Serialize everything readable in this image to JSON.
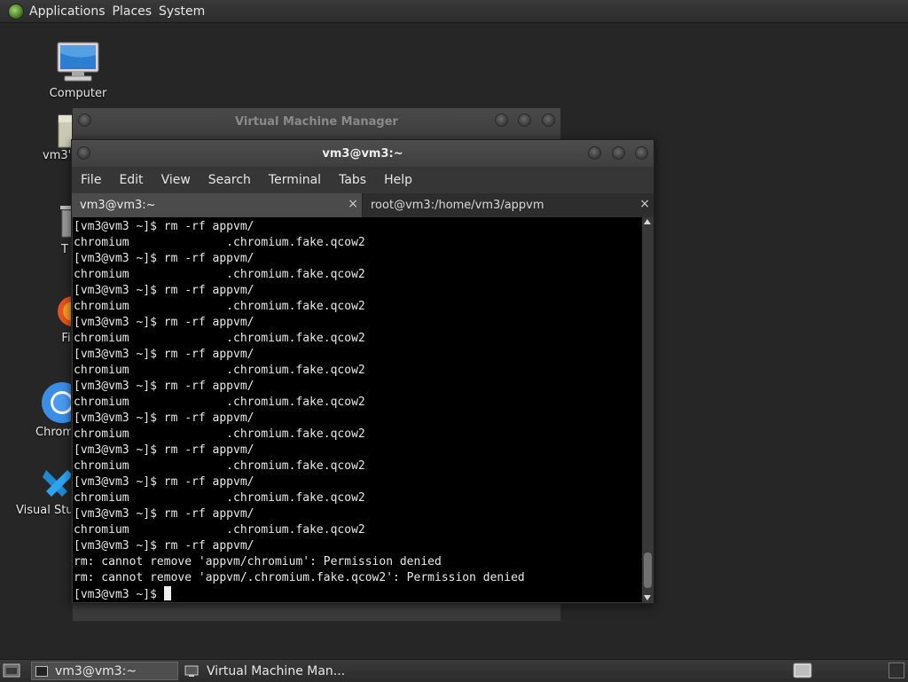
{
  "top_panel": {
    "menus": [
      "Applications",
      "Places",
      "System"
    ]
  },
  "desktop": {
    "icons": [
      {
        "label": "Computer"
      },
      {
        "label": "vm3'"
      },
      {
        "label": "T"
      },
      {
        "label": "Fi"
      },
      {
        "label": "Chrom"
      },
      {
        "label": "Visual Stuc"
      }
    ]
  },
  "vmm_window": {
    "title": "Virtual Machine Manager"
  },
  "terminal": {
    "title": "vm3@vm3:~",
    "menus": [
      "File",
      "Edit",
      "View",
      "Search",
      "Terminal",
      "Tabs",
      "Help"
    ],
    "tabs": [
      {
        "label": "vm3@vm3:~",
        "close": "×"
      },
      {
        "label": "root@vm3:/home/vm3/appvm",
        "close": "×"
      }
    ],
    "lines": [
      "[vm3@vm3 ~]$ rm -rf appvm/",
      "chromium              .chromium.fake.qcow2",
      "[vm3@vm3 ~]$ rm -rf appvm/",
      "chromium              .chromium.fake.qcow2",
      "[vm3@vm3 ~]$ rm -rf appvm/",
      "chromium              .chromium.fake.qcow2",
      "[vm3@vm3 ~]$ rm -rf appvm/",
      "chromium              .chromium.fake.qcow2",
      "[vm3@vm3 ~]$ rm -rf appvm/",
      "chromium              .chromium.fake.qcow2",
      "[vm3@vm3 ~]$ rm -rf appvm/",
      "chromium              .chromium.fake.qcow2",
      "[vm3@vm3 ~]$ rm -rf appvm/",
      "chromium              .chromium.fake.qcow2",
      "[vm3@vm3 ~]$ rm -rf appvm/",
      "chromium              .chromium.fake.qcow2",
      "[vm3@vm3 ~]$ rm -rf appvm/",
      "chromium              .chromium.fake.qcow2",
      "[vm3@vm3 ~]$ rm -rf appvm/",
      "chromium              .chromium.fake.qcow2",
      "[vm3@vm3 ~]$ rm -rf appvm/",
      "rm: cannot remove 'appvm/chromium': Permission denied",
      "rm: cannot remove 'appvm/.chromium.fake.qcow2': Permission denied"
    ],
    "prompt": "[vm3@vm3 ~]$ "
  },
  "taskbar": {
    "items": [
      {
        "label": "vm3@vm3:~"
      },
      {
        "label": "Virtual Machine Man..."
      }
    ]
  }
}
